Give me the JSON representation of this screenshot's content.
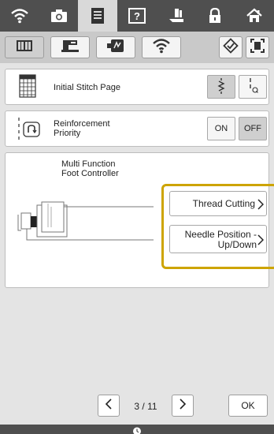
{
  "top_tabs": [
    {
      "icon": "wifi-icon",
      "active": false
    },
    {
      "icon": "camera-icon",
      "active": false
    },
    {
      "icon": "document-icon",
      "active": true
    },
    {
      "icon": "help-icon",
      "active": false
    },
    {
      "icon": "presser-foot-icon",
      "active": false
    },
    {
      "icon": "lock-icon",
      "active": false
    },
    {
      "icon": "home-icon",
      "active": false
    }
  ],
  "settings_tabs": [
    {
      "icon": "book-icon",
      "active": true
    },
    {
      "icon": "sewing-machine-icon",
      "active": false
    },
    {
      "icon": "embroidery-frame-icon",
      "active": false
    },
    {
      "icon": "wifi-icon",
      "active": false
    }
  ],
  "initial_stitch": {
    "label": "Initial Stitch Page"
  },
  "reinforcement": {
    "label_line1": "Reinforcement",
    "label_line2": "Priority",
    "on": "ON",
    "off": "OFF",
    "selected": "OFF"
  },
  "foot_controller": {
    "label_line1": "Multi Function",
    "label_line2": "Foot Controller",
    "thread_cutting": "Thread Cutting",
    "needle_position_line1": "Needle Position -",
    "needle_position_line2": "Up/Down"
  },
  "pager": {
    "text": "3 / 11"
  },
  "ok_label": "OK",
  "colors": {
    "highlight": "#cda400",
    "topbar": "#4f4f4f",
    "panel": "#e4e4e4"
  }
}
